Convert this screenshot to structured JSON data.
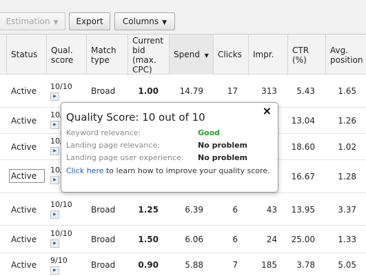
{
  "toolbar": {
    "estimation_label": "Estimation",
    "export_label": "Export",
    "columns_label": "Columns",
    "dropdown_glyph": "▼"
  },
  "columns": {
    "status": "Status",
    "qual_score": [
      "Qual.",
      "score"
    ],
    "match_type": [
      "Match",
      "type"
    ],
    "current_bid": [
      "Current",
      "bid",
      "(max.",
      "CPC)"
    ],
    "spend": "Spend",
    "spend_sort_glyph": "▼",
    "clicks": "Clicks",
    "impr": "Impr.",
    "ctr": [
      "CTR",
      "(%)"
    ],
    "avg_position": [
      "Avg.",
      "position"
    ]
  },
  "rows": [
    {
      "status": "Active",
      "qual_score": "10/10",
      "match_type": "Broad",
      "bid": "1.00",
      "spend": "14.79",
      "clicks": "17",
      "impr": "313",
      "ctr": "5.43",
      "avg_position": "1.65"
    },
    {
      "status": "Active",
      "qual_score": "10/10",
      "match_type": "",
      "bid": "",
      "spend": "",
      "clicks": "",
      "impr": "",
      "ctr": "13.04",
      "avg_position": "1.26"
    },
    {
      "status": "Active",
      "qual_score": "10/10",
      "match_type": "",
      "bid": "",
      "spend": "",
      "clicks": "",
      "impr": "",
      "ctr": "18.60",
      "avg_position": "1.02"
    },
    {
      "status": "Active",
      "qual_score": "10/10",
      "match_type": "",
      "bid": "",
      "spend": "",
      "clicks": "",
      "impr": "",
      "ctr": "16.67",
      "avg_position": "1.28"
    },
    {
      "status": "Active",
      "qual_score": "10/10",
      "match_type": "Broad",
      "bid": "1.25",
      "spend": "6.39",
      "clicks": "6",
      "impr": "43",
      "ctr": "13.95",
      "avg_position": "3.37"
    },
    {
      "status": "Active",
      "qual_score": "10/10",
      "match_type": "Broad",
      "bid": "1.50",
      "spend": "6.06",
      "clicks": "6",
      "impr": "24",
      "ctr": "25.00",
      "avg_position": "1.33"
    },
    {
      "status": "Active",
      "qual_score": "9/10",
      "match_type": "Broad",
      "bid": "0.90",
      "spend": "5.88",
      "clicks": "7",
      "impr": "185",
      "ctr": "3.78",
      "avg_position": "5.05"
    }
  ],
  "popup": {
    "title": "Quality Score: 10 out of 10",
    "close_glyph": "×",
    "items": [
      {
        "label": "Keyword relevance:",
        "value": "Good",
        "value_color": "#2a9a2a"
      },
      {
        "label": "Landing page relevance:",
        "value": "No problem"
      },
      {
        "label": "Landing page user experience:",
        "value": "No problem"
      }
    ],
    "link_text": "Click here",
    "link_suffix": " to learn how to improve your quality score."
  },
  "colors": {
    "link": "#1d5ec4",
    "good": "#2a9a2a",
    "header_bg": "#f3f3f3"
  }
}
